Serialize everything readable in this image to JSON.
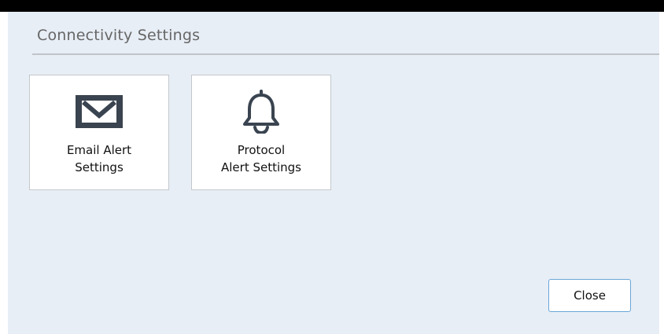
{
  "dialog": {
    "title": "Connectivity Settings"
  },
  "tiles": [
    {
      "label": "Email Alert\nSettings",
      "icon": "envelope-icon"
    },
    {
      "label": "Protocol\nAlert Settings",
      "icon": "bell-icon"
    }
  ],
  "footer": {
    "close_label": "Close"
  },
  "colors": {
    "dialog_background": "#e8eef6",
    "icon": "#3a4450",
    "close_border": "#6aa6d8"
  }
}
